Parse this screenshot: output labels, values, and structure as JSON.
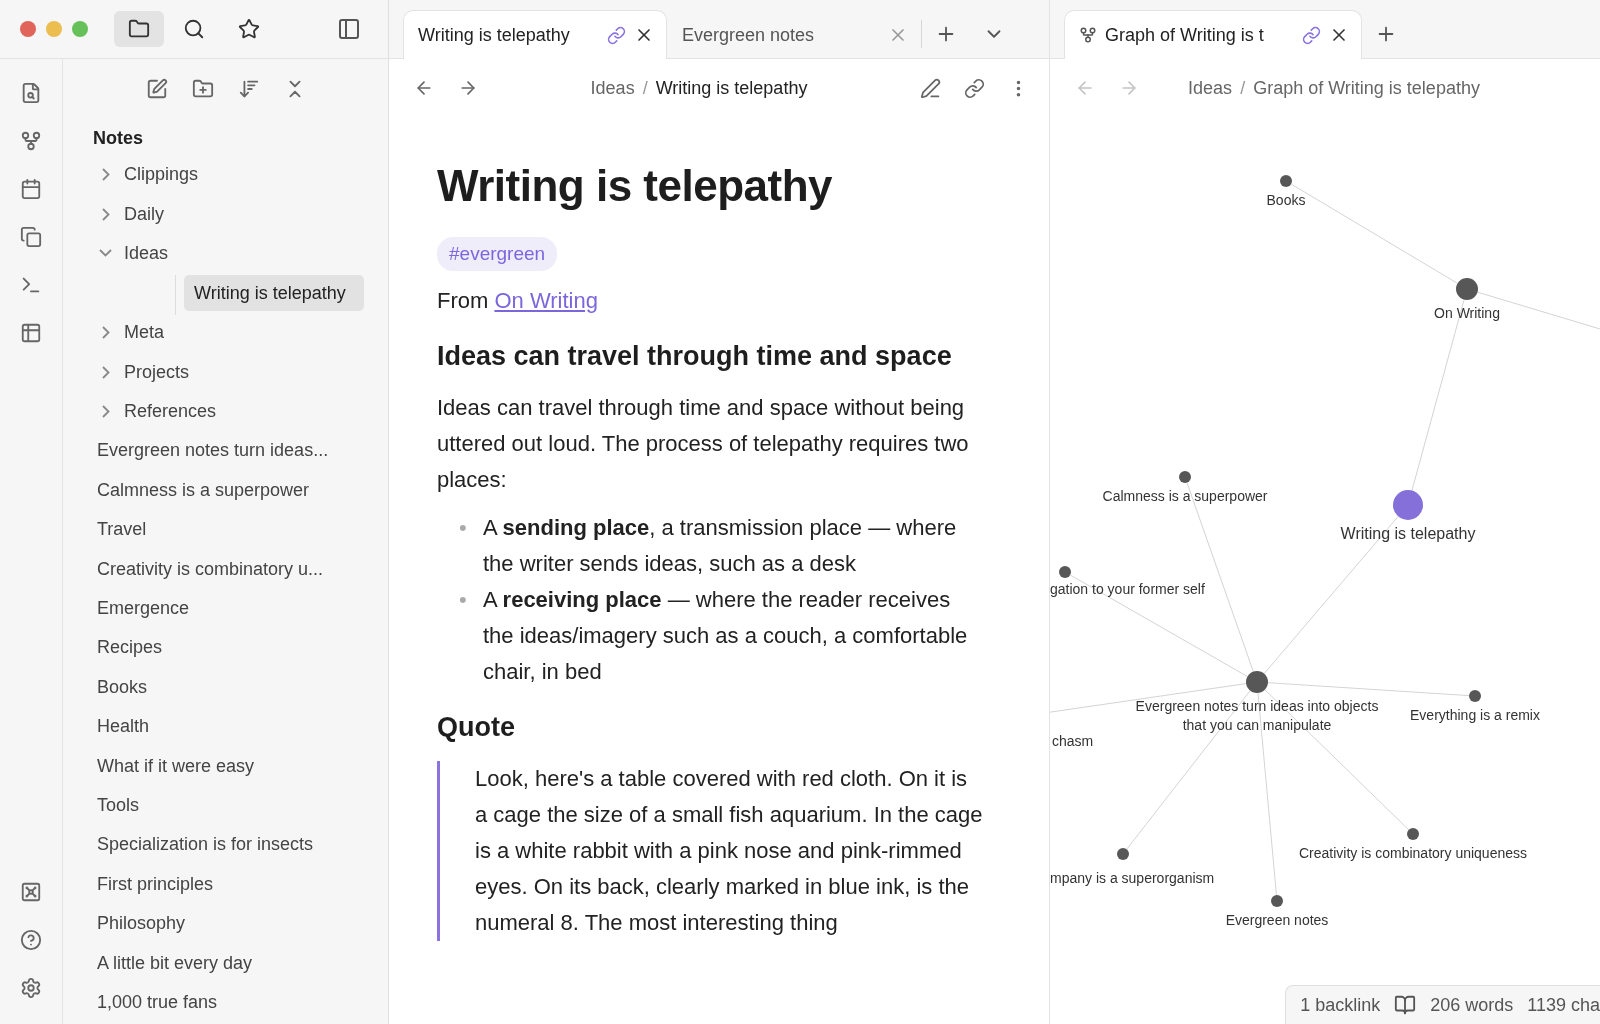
{
  "titlebar": {
    "tools": [
      {
        "kind": "folder",
        "selected": true
      },
      {
        "kind": "search",
        "selected": false
      },
      {
        "kind": "star",
        "selected": false
      }
    ]
  },
  "sidebar_toolbar": [
    {
      "kind": "new-note"
    },
    {
      "kind": "new-folder"
    },
    {
      "kind": "sort"
    },
    {
      "kind": "collapse"
    }
  ],
  "sidebar": {
    "title": "Notes",
    "items": [
      {
        "label": "Clippings",
        "kind": "folder",
        "expanded": false,
        "selected": false
      },
      {
        "label": "Daily",
        "kind": "folder",
        "expanded": false,
        "selected": false
      },
      {
        "label": "Ideas",
        "kind": "folder",
        "expanded": true,
        "selected": false,
        "children": [
          {
            "label": "Writing is telepathy",
            "selected": true
          }
        ]
      },
      {
        "label": "Meta",
        "kind": "folder",
        "expanded": false,
        "selected": false
      },
      {
        "label": "Projects",
        "kind": "folder",
        "expanded": false,
        "selected": false
      },
      {
        "label": "References",
        "kind": "folder",
        "expanded": false,
        "selected": false
      },
      {
        "label": "Evergreen notes turn ideas...",
        "kind": "file",
        "selected": false
      },
      {
        "label": "Calmness is a superpower",
        "kind": "file",
        "selected": false
      },
      {
        "label": "Travel",
        "kind": "file",
        "selected": false
      },
      {
        "label": "Creativity is combinatory u...",
        "kind": "file",
        "selected": false
      },
      {
        "label": "Emergence",
        "kind": "file",
        "selected": false
      },
      {
        "label": "Recipes",
        "kind": "file",
        "selected": false
      },
      {
        "label": "Books",
        "kind": "file",
        "selected": false
      },
      {
        "label": "Health",
        "kind": "file",
        "selected": false
      },
      {
        "label": "What if it were easy",
        "kind": "file",
        "selected": false
      },
      {
        "label": "Tools",
        "kind": "file",
        "selected": false
      },
      {
        "label": "Specialization is for insects",
        "kind": "file",
        "selected": false
      },
      {
        "label": "First principles",
        "kind": "file",
        "selected": false
      },
      {
        "label": "Philosophy",
        "kind": "file",
        "selected": false
      },
      {
        "label": "A little bit every day",
        "kind": "file",
        "selected": false
      },
      {
        "label": "1,000 true fans",
        "kind": "file",
        "selected": false
      }
    ]
  },
  "editor": {
    "tabs": [
      {
        "label": "Writing is telepathy",
        "selected": true,
        "linked": true
      },
      {
        "label": "Evergreen notes",
        "selected": false,
        "linked": false
      }
    ],
    "breadcrumb": [
      "Ideas",
      "Writing is telepathy"
    ],
    "breadcrumb_separator": "/",
    "title": "Writing is telepathy",
    "tag": "#evergreen",
    "from_prefix": "From",
    "from_link": "On Writing",
    "blocks": [
      {
        "kind": "heading",
        "text": "Ideas can travel through time and space"
      },
      {
        "kind": "paragraph",
        "text": "Ideas can travel through time and space without being uttered out loud. The process of telepathy requires two places:"
      },
      {
        "kind": "list",
        "marker": "•",
        "items": [
          "A **sending place**, a transmission place — where the writer sends ideas, such as a desk",
          "A **receiving place** — where the reader receives the ideas/imagery such as a couch, a comfortable chair, in bed"
        ]
      },
      {
        "kind": "heading",
        "text": "Quote"
      },
      {
        "kind": "quote",
        "text": "Look, here's a table covered with red cloth. On it is a cage the size of a small fish aquarium. In the cage is a white rabbit with a pink nose and pink-rimmed eyes. On its back, clearly marked in blue ink, is the numeral 8. The most interesting thing"
      }
    ]
  },
  "graph_pane": {
    "tab": {
      "label": "Graph of Writing is t",
      "selected": true,
      "linked": true
    },
    "breadcrumb": [
      "Ideas",
      "Graph of Writing is telepathy"
    ],
    "breadcrumb_separator": "/",
    "nodes": [
      {
        "label": "Books",
        "kind": "note"
      },
      {
        "label": "On Writing",
        "kind": "hub"
      },
      {
        "label": "Writing is telepathy",
        "kind": "current"
      },
      {
        "label": "Calmness is a superpower",
        "kind": "note"
      },
      {
        "label": "gation to your former self",
        "kind": "note"
      },
      {
        "label": "Evergreen notes turn ideas into objects that you can manipulate",
        "kind": "hub"
      },
      {
        "label": "Everything is a remix",
        "kind": "note"
      },
      {
        "label": "chasm",
        "kind": "hidden"
      },
      {
        "label": "mpany is a superorganism",
        "kind": "note"
      },
      {
        "label": "Creativity is combinatory uniqueness",
        "kind": "note"
      },
      {
        "label": "Evergreen notes",
        "kind": "note"
      }
    ]
  },
  "status_bar": {
    "backlinks": "1 backlink",
    "words": "206 words",
    "characters": "1139 cha"
  }
}
